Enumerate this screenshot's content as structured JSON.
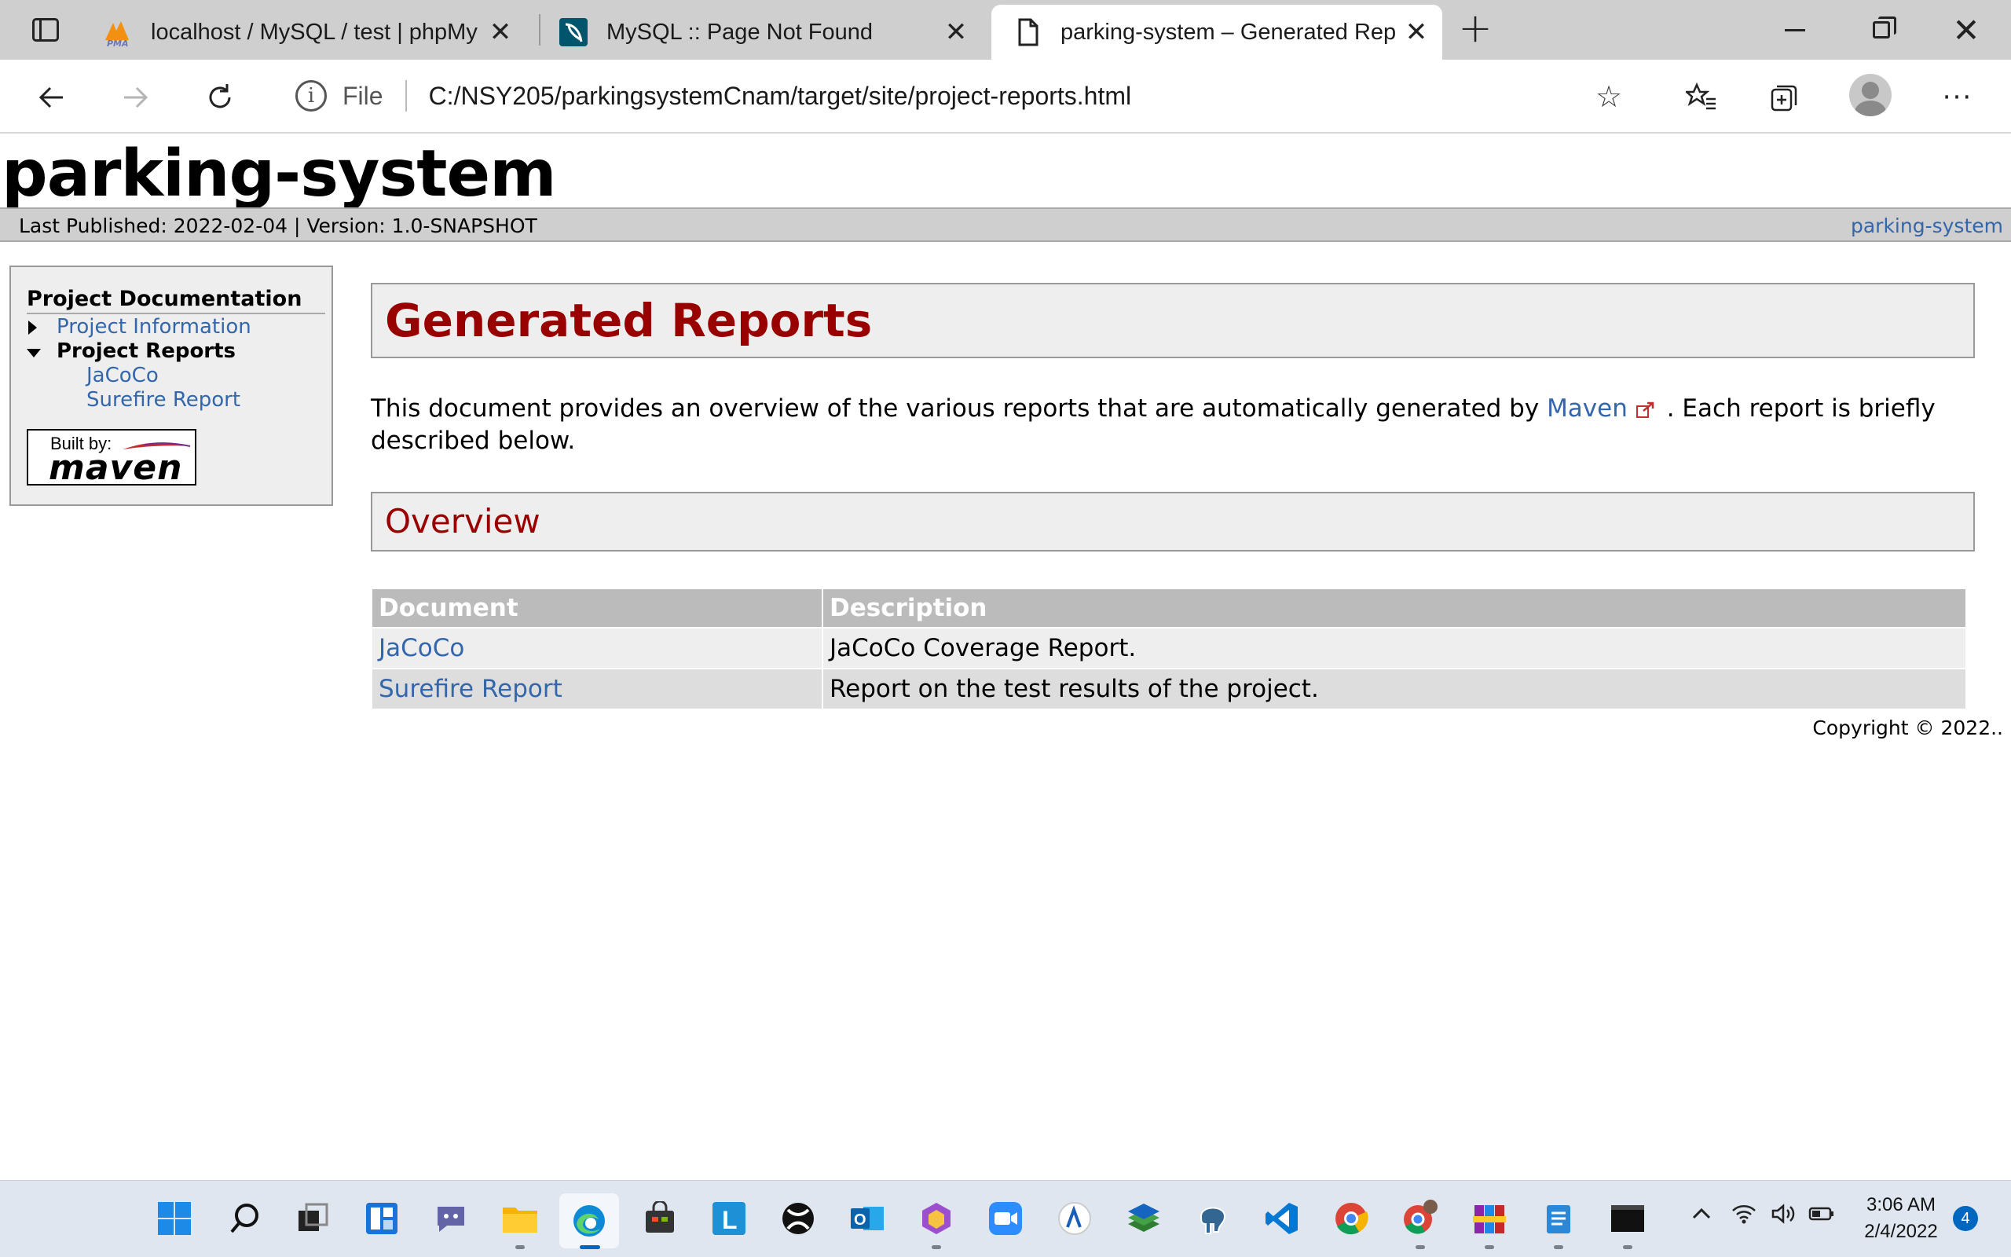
{
  "browser": {
    "tabs": [
      {
        "title": "localhost / MySQL / test | phpMy",
        "favicon": "phpmyadmin-icon",
        "active": false
      },
      {
        "title": "MySQL :: Page Not Found",
        "favicon": "mysql-dolphin-icon",
        "active": false
      },
      {
        "title": "parking-system – Generated Rep",
        "favicon": "page-icon",
        "active": true
      }
    ],
    "address": {
      "protocol_label": "File",
      "url": "C:/NSY205/parkingsystemCnam/target/site/project-reports.html"
    }
  },
  "page": {
    "banner_title": "parking-system",
    "breadcrumbs": {
      "published": "Last Published: 2022-02-04  |  Version: 1.0-SNAPSHOT",
      "project_link": "parking-system"
    },
    "sidebar": {
      "heading": "Project Documentation",
      "items": [
        {
          "label": "Project Information",
          "type": "collapsed"
        },
        {
          "label": "Project Reports",
          "type": "expanded"
        },
        {
          "label": "JaCoCo",
          "type": "child"
        },
        {
          "label": "Surefire Report",
          "type": "child"
        }
      ],
      "built_by": {
        "small": "Built by:",
        "big": "maven"
      }
    },
    "content": {
      "title": "Generated Reports",
      "intro_before": "This document provides an overview of the various reports that are automatically generated by ",
      "intro_link": "Maven",
      "intro_after": " . Each report is briefly described below.",
      "overview_heading": "Overview",
      "table": {
        "headers": [
          "Document",
          "Description"
        ],
        "rows": [
          {
            "document": "JaCoCo",
            "description": "JaCoCo Coverage Report."
          },
          {
            "document": "Surefire Report",
            "description": "Report on the test results of the project."
          }
        ]
      }
    },
    "footer": "Copyright © 2022.."
  },
  "taskbar": {
    "clock_time": "3:06 AM",
    "clock_date": "2/4/2022",
    "notification_count": "4"
  },
  "colors": {
    "heading_red": "#990000",
    "link_blue": "#3366aa",
    "taskbar_accent": "#0067c0"
  }
}
